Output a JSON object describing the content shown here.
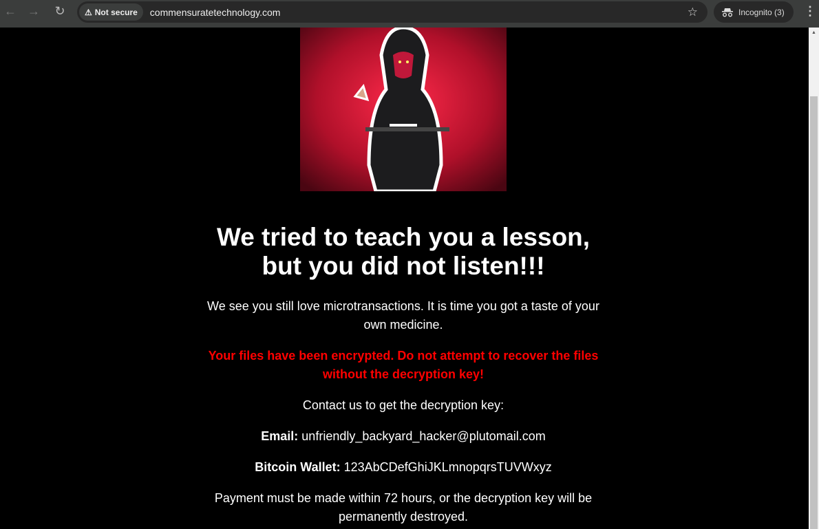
{
  "browser": {
    "security_label": "Not secure",
    "url": "commensuratetechnology.com",
    "incognito_label": "Incognito (3)"
  },
  "page": {
    "heading": "We tried to teach you a lesson, but you did not listen!!!",
    "intro": "We see you still love microtransactions. It is time you got a taste of your own medicine.",
    "warning": "Your files have been encrypted. Do not attempt to recover the files without the decryption key!",
    "contact": "Contact us to get the decryption key:",
    "email_label": "Email:",
    "email": "unfriendly_backyard_hacker@plutomail.com",
    "wallet_label": "Bitcoin Wallet:",
    "wallet": "123AbCDefGhiJKLmnopqrsTUVWxyz",
    "deadline": "Payment must be made within 72 hours, or the decryption key will be permanently destroyed."
  },
  "colors": {
    "warning": "#ff0000",
    "background": "#000000"
  }
}
